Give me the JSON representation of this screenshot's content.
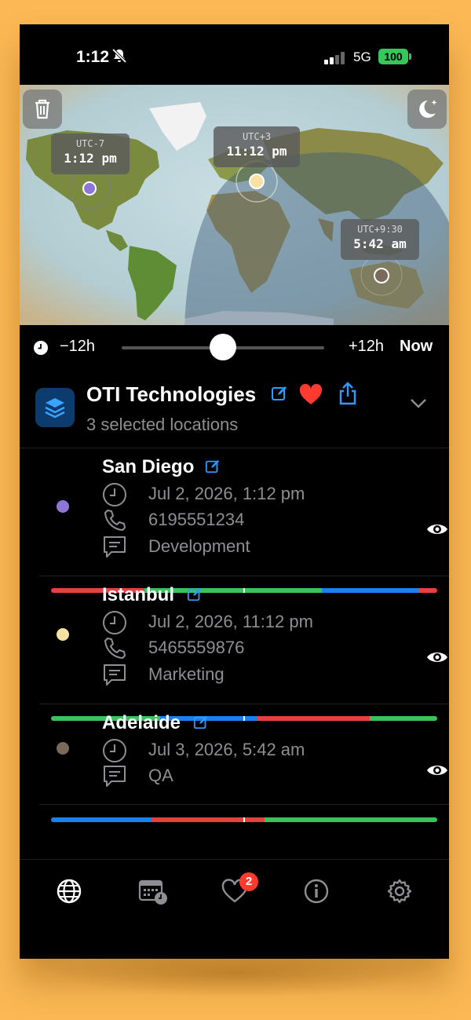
{
  "status_bar": {
    "time": "1:12",
    "network": "5G",
    "battery": "100"
  },
  "map": {
    "markers": [
      {
        "label": "UTC-7",
        "time": "1:12 pm",
        "color": "#8e76d6"
      },
      {
        "label": "UTC+3",
        "time": "11:12 pm",
        "color": "#f6e1a3"
      },
      {
        "label": "UTC+9:30",
        "time": "5:42 am",
        "color": "#7a6a5c"
      }
    ]
  },
  "time_slider": {
    "min_label": "−12h",
    "max_label": "+12h",
    "now_label": "Now",
    "value": 0.5
  },
  "group": {
    "title": "OTI Technologies",
    "subtitle": "3 selected locations",
    "icon": "layers-icon"
  },
  "locations": [
    {
      "name": "San Diego",
      "datetime": "Jul 2, 2026, 1:12 pm",
      "phone": "6195551234",
      "note": "Development",
      "dot_color": "#8e76d6"
    },
    {
      "name": "Istanbul",
      "datetime": "Jul 2, 2026, 11:12 pm",
      "phone": "5465559876",
      "note": "Marketing",
      "dot_color": "#f6e1a3"
    },
    {
      "name": "Adelaide",
      "datetime": "Jul 3, 2026, 5:42 am",
      "note": "QA",
      "dot_color": "#7a6a5c"
    }
  ],
  "tab_bar": {
    "tabs": [
      "globe-icon",
      "calendar-clock-icon",
      "heart-icon",
      "info-icon",
      "gear-icon"
    ],
    "badge": "2"
  },
  "colors": {
    "accent": "#2f9bff",
    "red": "#ff3b30",
    "green": "#35c759",
    "blue": "#1f7ef0",
    "bar_red": "#e8403c",
    "bar_green": "#3bc25a",
    "bar_blue": "#1e7ff0"
  }
}
